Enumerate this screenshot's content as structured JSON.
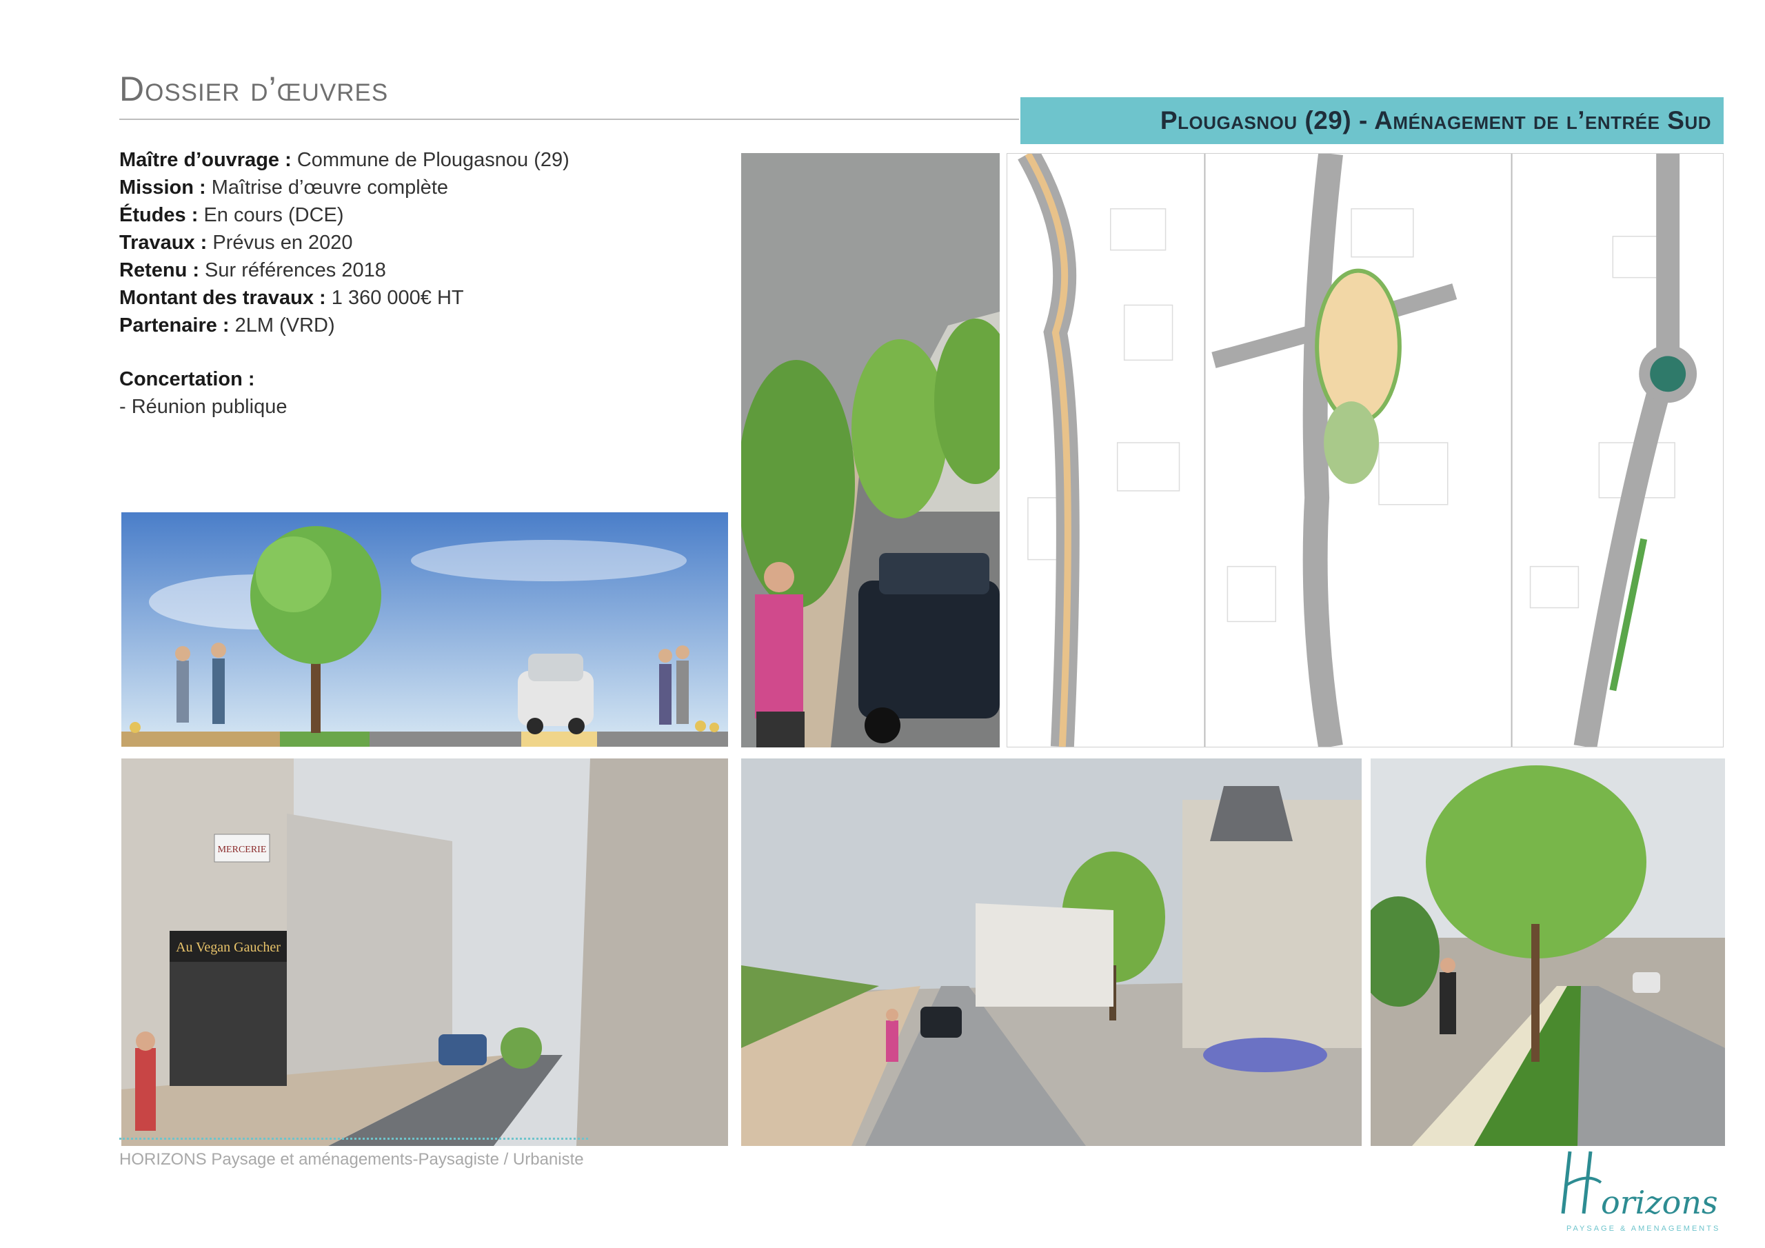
{
  "header": {
    "title": "Dossier d’œuvres",
    "project_banner": "Plougasnou (29) - Aménagement de l’entrée Sud"
  },
  "info": [
    {
      "label": "Maître d’ouvrage  :",
      "value": " Commune de Plougasnou (29)"
    },
    {
      "label": "Mission :",
      "value": " Maîtrise d’œuvre complète"
    },
    {
      "label": "Études :",
      "value": " En cours (DCE)"
    },
    {
      "label": "Travaux :",
      "value": " Prévus en 2020"
    },
    {
      "label": "Retenu :",
      "value": " Sur références 2018"
    },
    {
      "label": "Montant des travaux :",
      "value": " 1 360 000€ HT"
    },
    {
      "label": "Partenaire :",
      "value": " 2LM (VRD)"
    }
  ],
  "concertation": {
    "label": "Concertation :",
    "items": [
      "- Réunion publique"
    ]
  },
  "images": {
    "section_view": {
      "shop_sign": "Au Vegan Gaucher"
    },
    "street_photo": {
      "shop_sign": "Au Vegan Gaucher",
      "small_sign": "MERCERIE"
    }
  },
  "footer": {
    "text": "HORIZONS Paysage et aménagements-Paysagiste / Urbaniste"
  },
  "logo": {
    "name": "Horizons",
    "tagline": "PAYSAGE & AMENAGEMENTS"
  },
  "colors": {
    "accent": "#6ec4cc",
    "title_gray": "#6f6f6f"
  }
}
